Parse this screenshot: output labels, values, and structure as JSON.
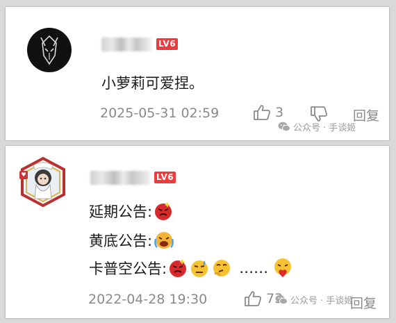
{
  "comments": [
    {
      "badge": "LV6",
      "text": "小萝莉可爱捏。",
      "date": "2025-05-31 02:59",
      "likes": "3",
      "reply_label": "回复",
      "avatar_icon": "dark-mask-avatar-icon"
    },
    {
      "badge": "LV6",
      "lines": [
        {
          "text": "延期公告:",
          "emojis": [
            "angry-red-face-emoji"
          ]
        },
        {
          "text": "黄底公告:",
          "emojis": [
            "crying-face-emoji"
          ]
        },
        {
          "text": "卡普空公告:",
          "emojis": [
            "angry-red-face-emoji",
            "sweating-face-emoji",
            "thinking-face-emoji"
          ],
          "trailing": "……",
          "trailing_emoji": "heart-hug-face-emoji"
        }
      ],
      "date": "2022-04-28 19:30",
      "likes": "73",
      "reply_label": "回复",
      "avatar_icon": "anime-girl-avatar-icon"
    }
  ],
  "watermark": {
    "text": "公众号 · 手谈姬",
    "icon": "wechat-icon"
  },
  "colors": {
    "badge": "#ee3b3b",
    "meta_text": "#8a8a8a",
    "background": "#d9d9d9"
  }
}
